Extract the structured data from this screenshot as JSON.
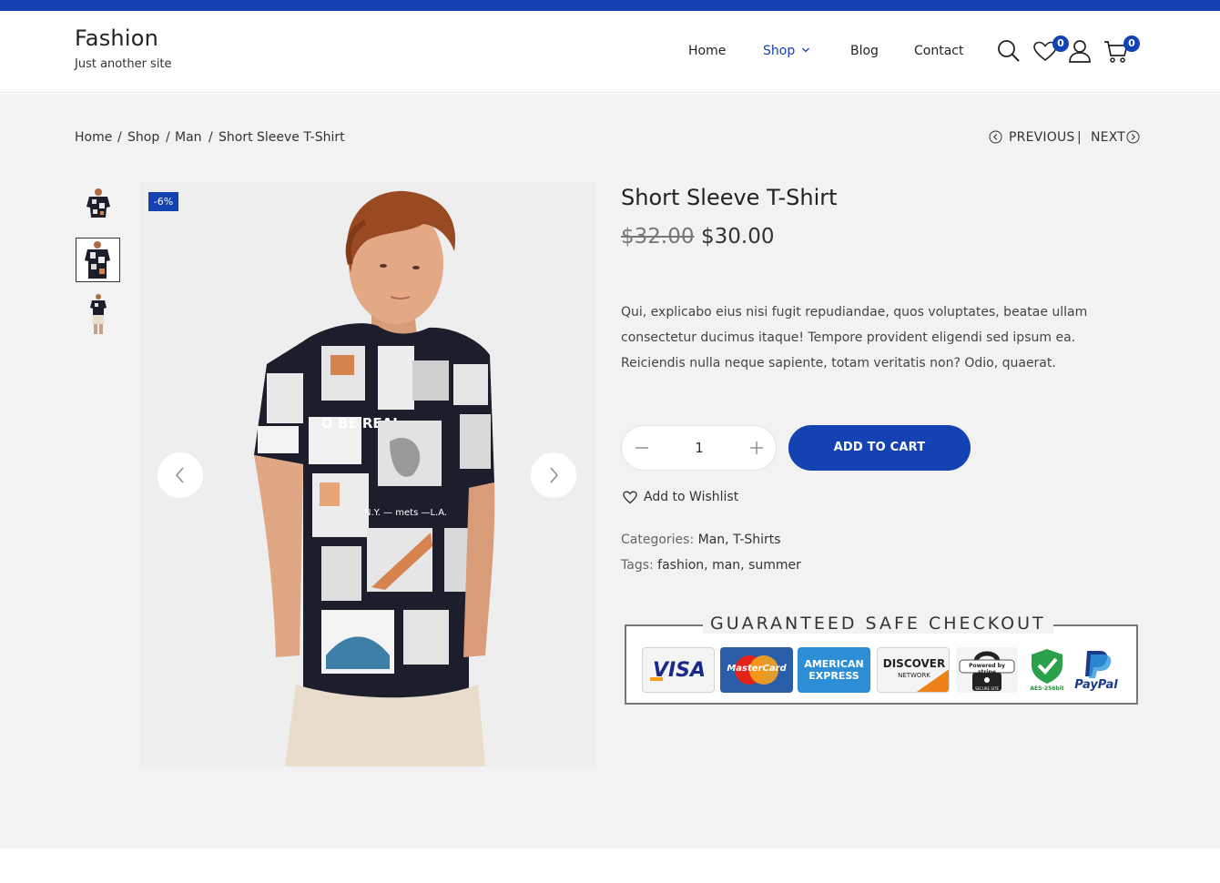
{
  "site": {
    "title": "Fashion",
    "tagline": "Just another site"
  },
  "nav": {
    "home": "Home",
    "shop": "Shop",
    "blog": "Blog",
    "contact": "Contact"
  },
  "header_icons": {
    "wishlist_count": "0",
    "cart_count": "0"
  },
  "breadcrumb": {
    "home": "Home",
    "shop": "Shop",
    "man": "Man",
    "current": "Short Sleeve T-Shirt",
    "sep": "/"
  },
  "pager": {
    "previous": "PREVIOUS",
    "sep": "|",
    "next": "NEXT"
  },
  "product": {
    "title": "Short Sleeve T-Shirt",
    "old_price": "$32.00",
    "price": "$30.00",
    "sale_badge": "-6%",
    "description": "Qui, explicabo eius nisi fugit repudiandae, quos voluptates, beatae ullam consectetur ducimus itaque! Tempore provident eligendi sed ipsum ea. Reiciendis nulla neque sapiente, totam veritatis non? Odio, quaerat.",
    "quantity": "1",
    "add_to_cart": "ADD TO CART",
    "wishlist": "Add to Wishlist",
    "categories_label": "Categories:",
    "categories": "Man, T-Shirts",
    "tags_label": "Tags:",
    "tags": "fashion, man, summer"
  },
  "checkout": {
    "title": "GUARANTEED SAFE CHECKOUT",
    "visa": "VISA",
    "mastercard": "MasterCard",
    "amex": "AMERICAN EXPRESS",
    "discover": "DISCOVER",
    "discover_sub": "NETWORK",
    "stripe": "Powered by stripe",
    "stripe_sub": "SECURE SITE",
    "aes": "AES-256bit",
    "paypal": "PayPal"
  },
  "colors": {
    "accent": "#1442b3",
    "background": "#f2f2f2"
  }
}
